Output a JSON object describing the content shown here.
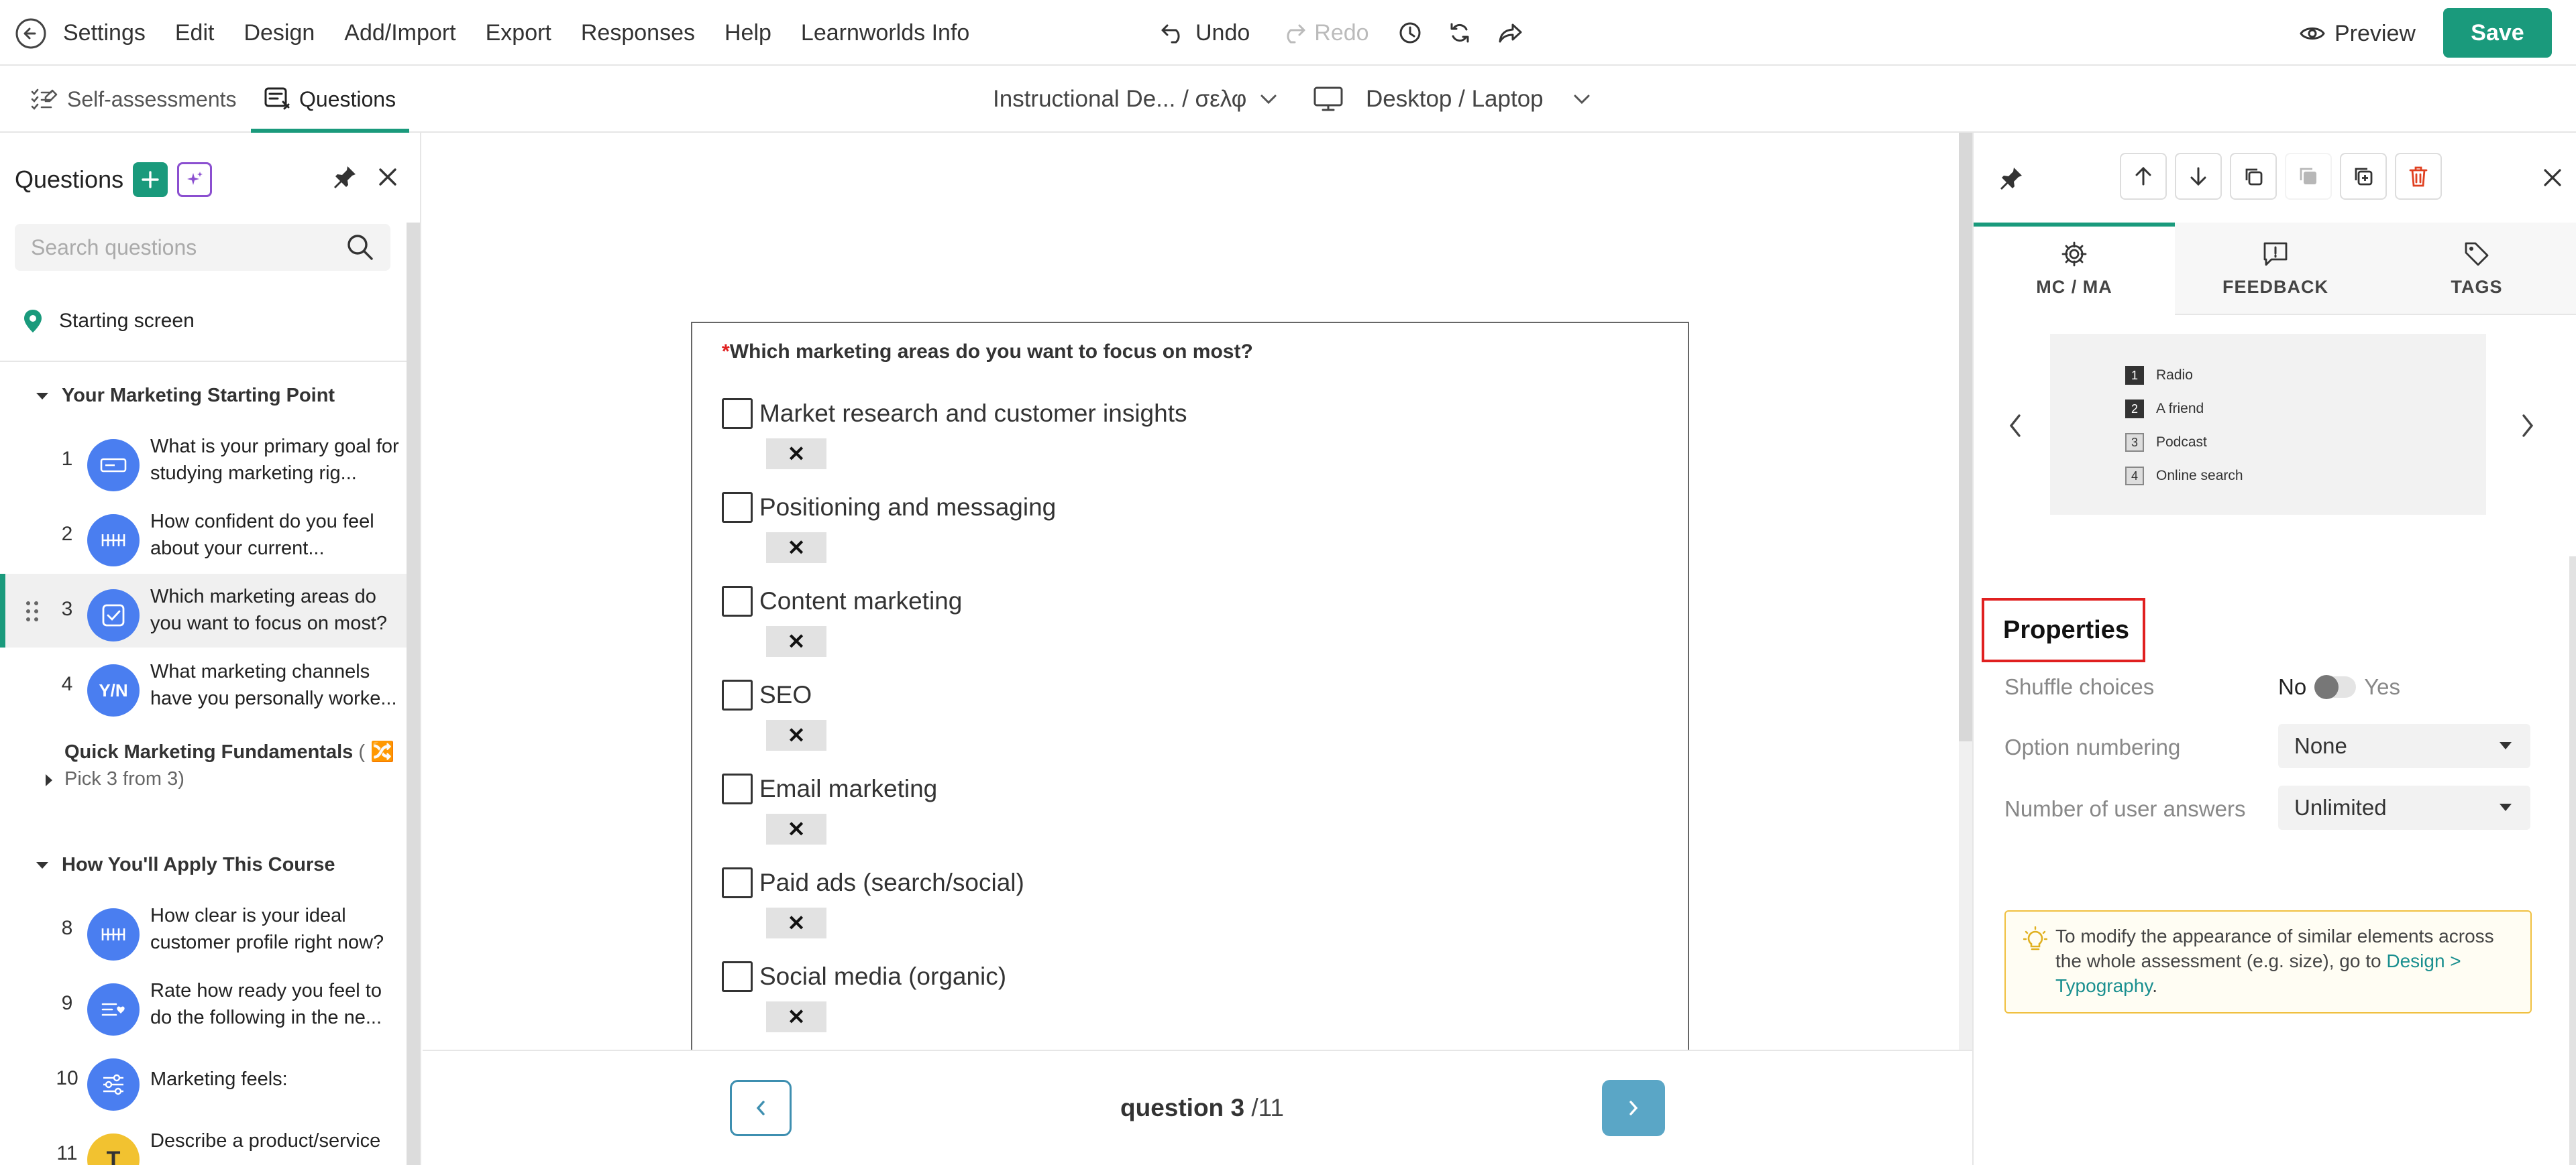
{
  "menu": {
    "items": [
      "Settings",
      "Edit",
      "Design",
      "Add/Import",
      "Export",
      "Responses",
      "Help",
      "Learnworlds Info"
    ],
    "undo": "Undo",
    "redo": "Redo",
    "preview": "Preview",
    "save": "Save"
  },
  "subbar": {
    "tab_self": "Self-assessments",
    "tab_questions": "Questions",
    "assessment_name": "Instructional De...  / σελφ",
    "device": "Desktop / Laptop"
  },
  "left": {
    "title": "Questions",
    "search_placeholder": "Search questions",
    "starting_screen": "Starting screen",
    "sections": {
      "s1": "Your Marketing Starting Point",
      "s2_bold": "Quick Marketing Fundamentals",
      "s2_rest": " ( 🔀 Pick 3 from 3)",
      "s3": "How You'll Apply This Course"
    },
    "questions": [
      {
        "num": "1",
        "text": "What is your primary goal for studying marketing rig...",
        "icon": "input-icon"
      },
      {
        "num": "2",
        "text": "How confident do you feel about your current...",
        "icon": "scale-icon"
      },
      {
        "num": "3",
        "text": "Which marketing areas do you want to focus on most?",
        "icon": "checkbox-icon"
      },
      {
        "num": "4",
        "text": "What marketing channels have you personally worke...",
        "icon": "yes-no-icon",
        "badge": "Y/N"
      },
      {
        "num": "8",
        "text": "How clear is your ideal customer profile right now?",
        "icon": "scale-icon"
      },
      {
        "num": "9",
        "text": "Rate how ready you feel to do the following in the ne...",
        "icon": "rating-list-icon"
      },
      {
        "num": "10",
        "text": "Marketing feels:",
        "icon": "sliders-icon"
      },
      {
        "num": "11",
        "text": "Describe a product/service",
        "icon": "text-icon",
        "badge": "T"
      }
    ]
  },
  "question": {
    "required_mark": "*",
    "title": "Which marketing areas do you want to focus on most?",
    "options": [
      "Market research and customer insights",
      "Positioning and messaging",
      "Content marketing",
      "SEO",
      "Email marketing",
      "Paid ads (search/social)",
      "Social media (organic)"
    ],
    "remove_label": "✕"
  },
  "footer": {
    "label": "question",
    "current": "3",
    "total": "/11"
  },
  "right": {
    "tabs": [
      "MC / MA",
      "FEEDBACK",
      "TAGS"
    ],
    "carousel": [
      {
        "num": "1",
        "text": "Radio"
      },
      {
        "num": "2",
        "text": "A friend"
      },
      {
        "num": "3",
        "text": "Podcast"
      },
      {
        "num": "4",
        "text": "Online search"
      }
    ],
    "properties_title": "Properties",
    "shuffle_label": "Shuffle choices",
    "shuffle_no": "No",
    "shuffle_yes": "Yes",
    "shuffle_on": false,
    "numbering_label": "Option numbering",
    "numbering_value": "None",
    "answers_label": "Number of user answers",
    "answers_value": "Unlimited",
    "tip_text": "To modify the appearance of similar elements across the whole assessment (e.g. size), go to ",
    "tip_link": "Design > Typography",
    "tip_end": "."
  },
  "colors": {
    "accent": "#1a9a7c",
    "question_icon": "#4a7ef0",
    "text_icon": "#f2c230",
    "nav": "#5aa6c6",
    "highlight_box": "#e02020"
  }
}
